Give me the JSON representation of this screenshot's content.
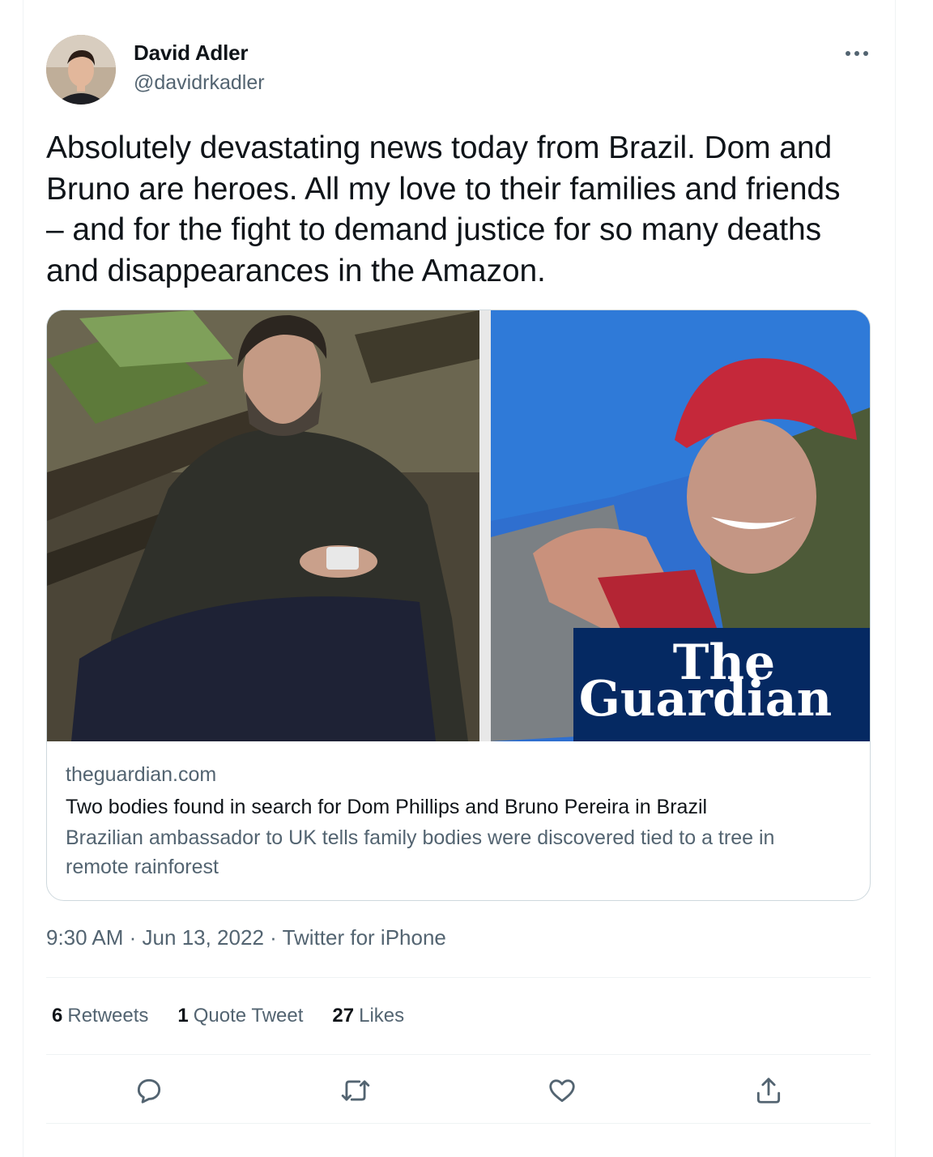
{
  "author": {
    "name": "David Adler",
    "handle": "@davidrkadler",
    "avatar_icon": "avatar-photo"
  },
  "tweet": {
    "text": "Absolutely devastating news today from Brazil. Dom and Bruno are heroes. All my love to their families and friends – and for the fight to demand justice for so many deaths and disappearances in the Amazon."
  },
  "card": {
    "image_watermark_line1": "The",
    "image_watermark_line2": "Guardian",
    "domain": "theguardian.com",
    "title": "Two bodies found in search for Dom Phillips and Bruno Pereira in Brazil",
    "description": "Brazilian ambassador to UK tells family bodies were discovered tied to a tree in remote rainforest"
  },
  "meta": {
    "time": "9:30 AM",
    "separator": "·",
    "date": "Jun 13, 2022",
    "source": "Twitter for iPhone"
  },
  "stats": {
    "retweets_count": "6",
    "retweets_label": "Retweets",
    "quotes_count": "1",
    "quotes_label": "Quote Tweet",
    "likes_count": "27",
    "likes_label": "Likes"
  },
  "actions": [
    "reply-icon",
    "retweet-icon",
    "like-icon",
    "share-icon"
  ],
  "colors": {
    "text_primary": "#0f1419",
    "text_secondary": "#536471",
    "border": "#cfd9de",
    "guardian_blue": "#052962"
  }
}
